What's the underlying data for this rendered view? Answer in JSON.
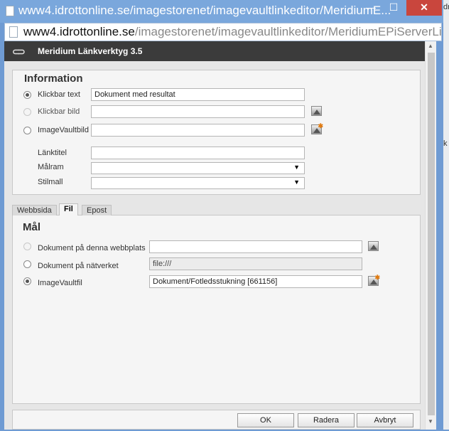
{
  "window": {
    "title": "www4.idrottonline.se/imagestorenet/imagevaultlinkeditor/MeridiumE...",
    "minimize_glyph": "—",
    "maximize_glyph": "☐",
    "close_glyph": "✕",
    "side_chars": [
      "dr",
      "k"
    ]
  },
  "address": {
    "host": "www4.idrottonline.se",
    "path": "/imagestorenet/imagevaultlinkeditor/MeridiumEPiServerLinkI"
  },
  "dialog": {
    "title": "Meridium Länkverktyg 3.5",
    "logo_glyph": "⊂⊃",
    "logo_icon": "chain-link-icon"
  },
  "information": {
    "title": "Information",
    "rows": {
      "clickable_text": {
        "label": "Klickbar text",
        "value": "Dokument med resultat",
        "checked": true
      },
      "clickable_image": {
        "label": "Klickbar bild",
        "value": "",
        "icon": "image-picker-icon"
      },
      "imagevault_image": {
        "label": "ImageVaultbild",
        "value": "",
        "icon": "imagevault-picker-icon"
      },
      "link_title": {
        "label": "Länktitel",
        "value": ""
      },
      "target_frame": {
        "label": "Målram",
        "value": ""
      },
      "style": {
        "label": "Stilmall",
        "value": ""
      }
    },
    "select_arrow": "▼"
  },
  "tabs": [
    {
      "label": "Webbsida",
      "active": false
    },
    {
      "label": "Fil",
      "active": true
    },
    {
      "label": "Epost",
      "active": false
    }
  ],
  "target": {
    "title": "Mål",
    "rows": {
      "website_document": {
        "label": "Dokument på denna webbplats",
        "value": "",
        "icon": "image-picker-icon"
      },
      "network_document": {
        "label": "Dokument på nätverket",
        "value": "file:///"
      },
      "imagevault_file": {
        "label": "ImageVaultfil",
        "value": "Dokument/Fotledsstukning [661156]",
        "checked": true,
        "icon": "imagevault-picker-icon"
      }
    }
  },
  "buttons": {
    "ok": "OK",
    "delete": "Radera",
    "cancel": "Avbryt"
  },
  "scrollbar": {
    "up_glyph": "▲",
    "down_glyph": "▼"
  }
}
